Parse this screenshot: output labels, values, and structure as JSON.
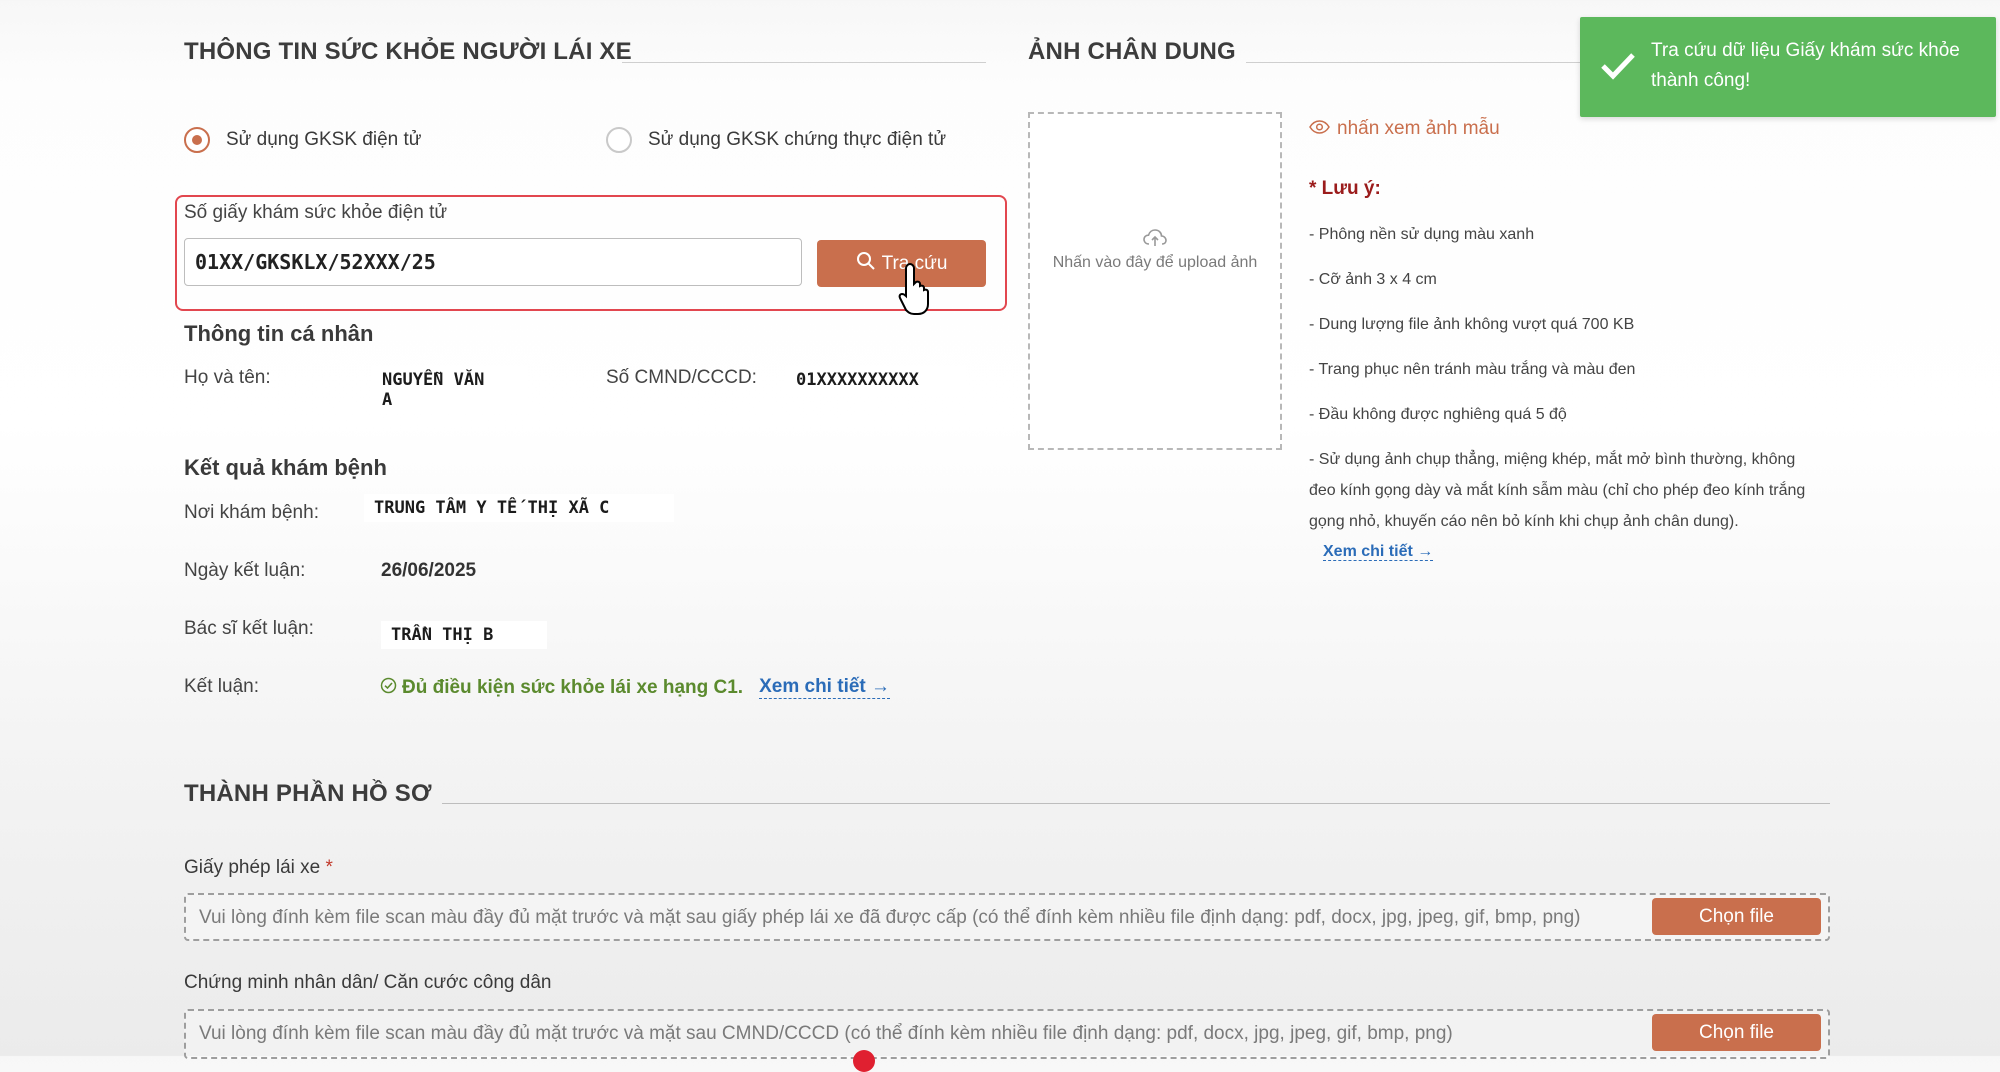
{
  "health_section": {
    "title": "THÔNG TIN SỨC KHỎE NGƯỜI LÁI XE",
    "radio_options": [
      {
        "label": "Sử dụng GKSK điện tử",
        "checked": true
      },
      {
        "label": "Sử dụng GKSK chứng thực điện tử",
        "checked": false
      }
    ],
    "lookup": {
      "label": "Số giấy khám sức khỏe điện tử",
      "value": "01XX/GKSKLX/52XXX/25",
      "button_label": "Tra cứu"
    },
    "personal": {
      "title": "Thông tin cá nhân",
      "name_label": "Họ và tên:",
      "name_value": "NGUYỄN VĂN\nA",
      "id_label": "Số CMND/CCCD:",
      "id_value": "01XXXXXXXXXX"
    },
    "result": {
      "title": "Kết quả khám bệnh",
      "place_label": "Nơi khám bệnh:",
      "place_value": "TRUNG TÂM Y TẾ THỊ XÃ C",
      "date_label": "Ngày kết luận:",
      "date_value": "26/06/2025",
      "doctor_label": "Bác sĩ kết luận:",
      "doctor_value": "TRẦN THỊ B",
      "conclusion_label": "Kết luận:",
      "conclusion_value": "Đủ điều kiện sức khỏe lái xe hạng C1.",
      "detail_link": "Xem chi tiết"
    }
  },
  "portrait_section": {
    "title": "ẢNH CHÂN DUNG",
    "upload_text": "Nhấn vào đây để upload ảnh",
    "sample_link": "nhấn xem ảnh mẫu",
    "note_title": "* Lưu ý:",
    "notes": [
      "- Phông nền sử dụng màu xanh",
      "- Cỡ ảnh 3 x 4 cm",
      "- Dung lượng file ảnh không vượt quá 700 KB",
      "- Trang phục nên tránh màu trắng và màu đen",
      "- Đầu không được nghiêng quá 5 độ"
    ],
    "long_note": [
      "- Sử dụng ảnh chụp thẳng, miệng khép, mắt mở bình thường, không",
      "đeo kính gọng dày và mắt kính sẫm màu (chỉ cho phép đeo kính trắng",
      "gọng nhỏ, khuyến cáo nên bỏ kính khi chụp ảnh chân dung)."
    ],
    "detail_link": "Xem chi tiết"
  },
  "documents_section": {
    "title": "THÀNH PHẦN HỒ SƠ",
    "items": [
      {
        "label": "Giấy phép lái xe",
        "required_mark": "*",
        "hint": "Vui lòng đính kèm file scan màu đầy đủ mặt trước và mặt sau giấy phép lái xe đã được cấp (có thể đính kèm nhiều file định dạng: pdf, docx, jpg, jpeg, gif, bmp, png)",
        "button_label": "Chọn file"
      },
      {
        "label": "Chứng minh nhân dân/ Căn cước công dân",
        "hint": "Vui lòng đính kèm file scan màu đầy đủ mặt trước và mặt sau CMND/CCCD (có thể đính kèm nhiều file định dạng: pdf, docx, jpg, jpeg, gif, bmp, png)",
        "button_label": "Chọn file"
      }
    ]
  },
  "toast": {
    "message": "Tra cứu dữ liệu Giấy khám sức khỏe thành công!"
  },
  "colors": {
    "accent": "#c96f4d",
    "success": "#5cb85c",
    "link": "#2b6cb8",
    "highlight_border": "#e2474f",
    "ok_text": "#5b8a2e"
  }
}
